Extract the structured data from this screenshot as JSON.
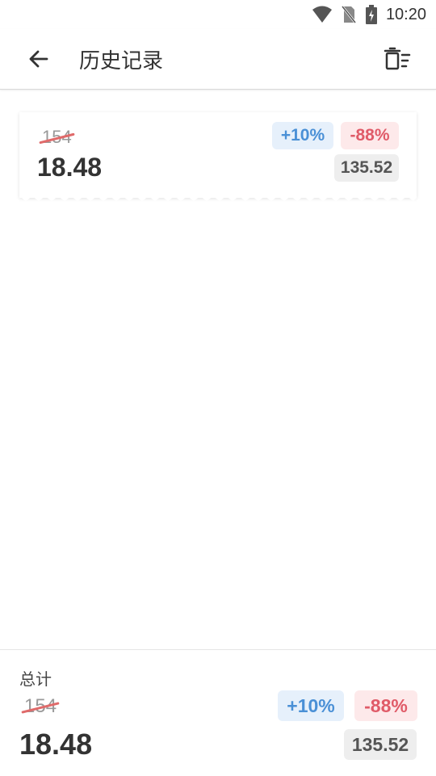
{
  "status_bar": {
    "time": "10:20",
    "icons": [
      "wifi-icon",
      "no-sim-icon",
      "battery-charging-icon"
    ]
  },
  "app_bar": {
    "title": "历史记录",
    "back_icon": "arrow-left-icon",
    "clear_icon": "delete-list-icon"
  },
  "history": [
    {
      "original": "154",
      "final": "18.48",
      "markup": "+10%",
      "discount": "-88%",
      "amount": "135.52"
    }
  ],
  "total": {
    "label": "总计",
    "original": "154",
    "final": "18.48",
    "markup": "+10%",
    "discount": "-88%",
    "amount": "135.52"
  },
  "colors": {
    "markup_text": "#4a90d6",
    "markup_bg": "#e6f0fb",
    "discount_text": "#e05b68",
    "discount_bg": "#fde9ea",
    "strike": "#e06a6a"
  }
}
